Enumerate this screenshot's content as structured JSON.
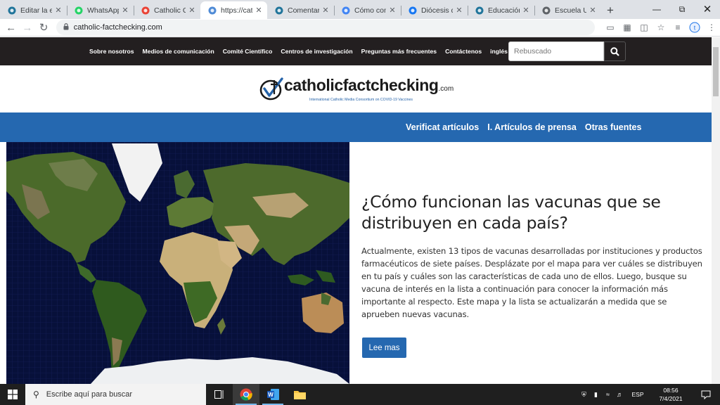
{
  "browser": {
    "tabs": [
      {
        "title": "Editar la entrada",
        "favicon": "wordpress-icon",
        "color": "#21759b"
      },
      {
        "title": "WhatsApp",
        "favicon": "whatsapp-icon",
        "color": "#25d366"
      },
      {
        "title": "Catholic Con",
        "favicon": "gmail-icon",
        "color": "#ea4335"
      },
      {
        "title": "https://catho",
        "favicon": "loading-icon",
        "color": "#4f8bd6",
        "active": true
      },
      {
        "title": "Comentarios",
        "favicon": "wordpress-icon",
        "color": "#21759b"
      },
      {
        "title": "Cómo comp",
        "favicon": "google-icon",
        "color": "#4285f4"
      },
      {
        "title": "Diócesis de",
        "favicon": "facebook-icon",
        "color": "#1877f2"
      },
      {
        "title": "Educación",
        "favicon": "wordpress-icon",
        "color": "#21759b"
      },
      {
        "title": "Escuela Uni",
        "favicon": "globe-icon",
        "color": "#5f6368"
      }
    ],
    "new_tab": "+",
    "url": "catholic-factchecking.com"
  },
  "site": {
    "nav": [
      "Sobre nosotros",
      "Medios de comunicación",
      "Comité Científico",
      "Centros de investigación",
      "Preguntas más frecuentes",
      "Contáctenos",
      "inglés"
    ],
    "search_placeholder": "Rebuscado",
    "logo": {
      "name": "catholicfactchecking",
      "suffix": ".com",
      "tagline": "International Catholic Media Consortium on COVID-19 Vaccines"
    },
    "menu": [
      "Verificat artículos",
      "I. Artículos de prensa",
      "Otras fuentes"
    ],
    "article": {
      "title": "¿Cómo funcionan las vacunas que se distribuyen en cada país?",
      "body": "Actualmente, existen 13 tipos de vacunas desarrolladas por instituciones y productos farmacéuticos de siete países. Desplázate por el mapa para ver cuáles se distribuyen en tu país y cuáles son las características de cada uno de ellos. Luego, busque su vacuna de interés en la lista a continuación para conocer la información más importante al respecto. Este mapa y la lista se actualizarán a medida que se aprueben nuevas vacunas.",
      "button": "Lee mas"
    },
    "colors": {
      "topbar": "#231f20",
      "brand_blue": "#2568b0"
    }
  },
  "taskbar": {
    "search_placeholder": "Escribe aquí para buscar",
    "language": "ESP",
    "time": "08:56",
    "date": "7/4/2021"
  }
}
